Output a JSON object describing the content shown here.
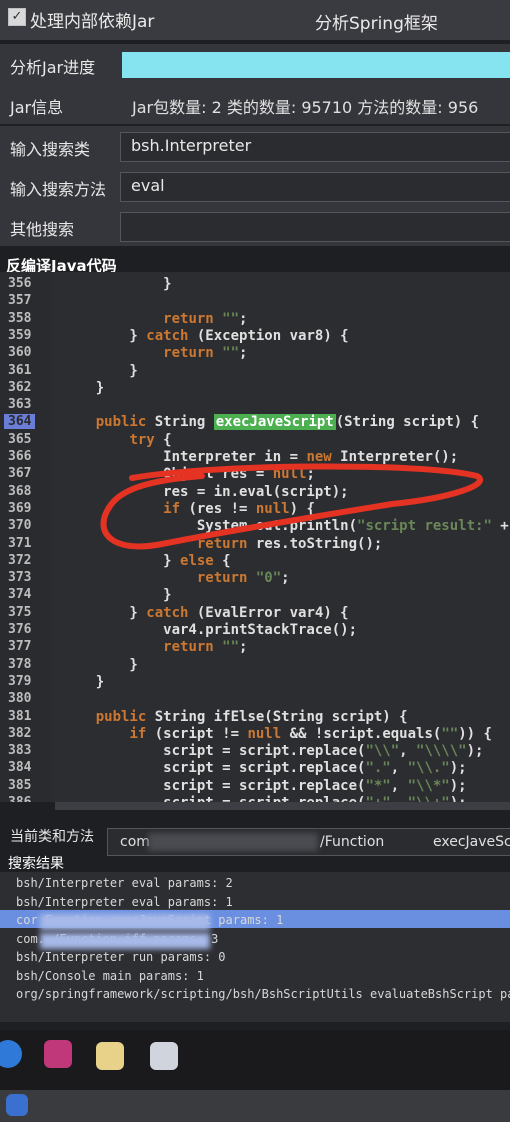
{
  "title": {
    "left": "处理内部依赖Jar",
    "right": "分析Spring框架"
  },
  "progress": {
    "label": "分析Jar进度",
    "fraction": 1.0
  },
  "jarinfo": {
    "label": "Jar信息",
    "text": "Jar包数量: 2   类的数量: 95710   方法的数量: 956"
  },
  "search_class": {
    "label": "输入搜索类",
    "value": "bsh.Interpreter"
  },
  "search_method": {
    "label": "输入搜索方法",
    "value": "eval"
  },
  "other_search": {
    "label": "其他搜索",
    "value": ""
  },
  "code_title": "反编译Java代码",
  "code_lines": [
    {
      "n": "356",
      "t": "            }"
    },
    {
      "n": "357",
      "t": ""
    },
    {
      "n": "358",
      "t": "            return \"\";"
    },
    {
      "n": "359",
      "t": "        } catch (Exception var8) {"
    },
    {
      "n": "360",
      "t": "            return \"\";"
    },
    {
      "n": "361",
      "t": "        }"
    },
    {
      "n": "362",
      "t": "    }"
    },
    {
      "n": "363",
      "t": ""
    },
    {
      "n": "364",
      "t": "    public String execJaveScript(String script) {"
    },
    {
      "n": "365",
      "t": "        try {"
    },
    {
      "n": "366",
      "t": "            Interpreter in = new Interpreter();"
    },
    {
      "n": "367",
      "t": "            Object res = null;"
    },
    {
      "n": "368",
      "t": "            res = in.eval(script);"
    },
    {
      "n": "369",
      "t": "            if (res != null) {"
    },
    {
      "n": "370",
      "t": "                System.out.println(\"script result:\" + r"
    },
    {
      "n": "371",
      "t": "                return res.toString();"
    },
    {
      "n": "372",
      "t": "            } else {"
    },
    {
      "n": "373",
      "t": "                return \"0\";"
    },
    {
      "n": "374",
      "t": "            }"
    },
    {
      "n": "375",
      "t": "        } catch (EvalError var4) {"
    },
    {
      "n": "376",
      "t": "            var4.printStackTrace();"
    },
    {
      "n": "377",
      "t": "            return \"\";"
    },
    {
      "n": "378",
      "t": "        }"
    },
    {
      "n": "379",
      "t": "    }"
    },
    {
      "n": "380",
      "t": ""
    },
    {
      "n": "381",
      "t": "    public String ifElse(String script) {"
    },
    {
      "n": "382",
      "t": "        if (script != null && !script.equals(\"\")) {"
    },
    {
      "n": "383",
      "t": "            script = script.replace(\"\\\\\", \"\\\\\\\\\");"
    },
    {
      "n": "384",
      "t": "            script = script.replace(\".\", \"\\\\.\");"
    },
    {
      "n": "385",
      "t": "            script = script.replace(\"*\", \"\\\\*\");"
    },
    {
      "n": "386",
      "t": "            script = script.replace(\"+\", \"\\\\+\");"
    }
  ],
  "current": {
    "label": "当前类和方法",
    "class_prefix": "com",
    "class_suffix": "/Function",
    "method": "execJaveSc"
  },
  "results": {
    "label": "搜索结果",
    "items": [
      "bsh/Interpreter  eval  params: 2",
      "bsh/Interpreter  eval  params: 1",
      "cor                        Function  execJaveScript  params: 1",
      "com.                     /Function  iff  params: 3",
      "bsh/Interpreter  run  params: 0",
      "bsh/Console  main  params: 1",
      "org/springframework/scripting/bsh/BshScriptUtils  evaluateBshScript  para"
    ]
  },
  "colors": {
    "accent": "#86e4f0",
    "selection": "#6b8fe0",
    "highlight": "#4caf50",
    "annotation": "#e53323"
  }
}
